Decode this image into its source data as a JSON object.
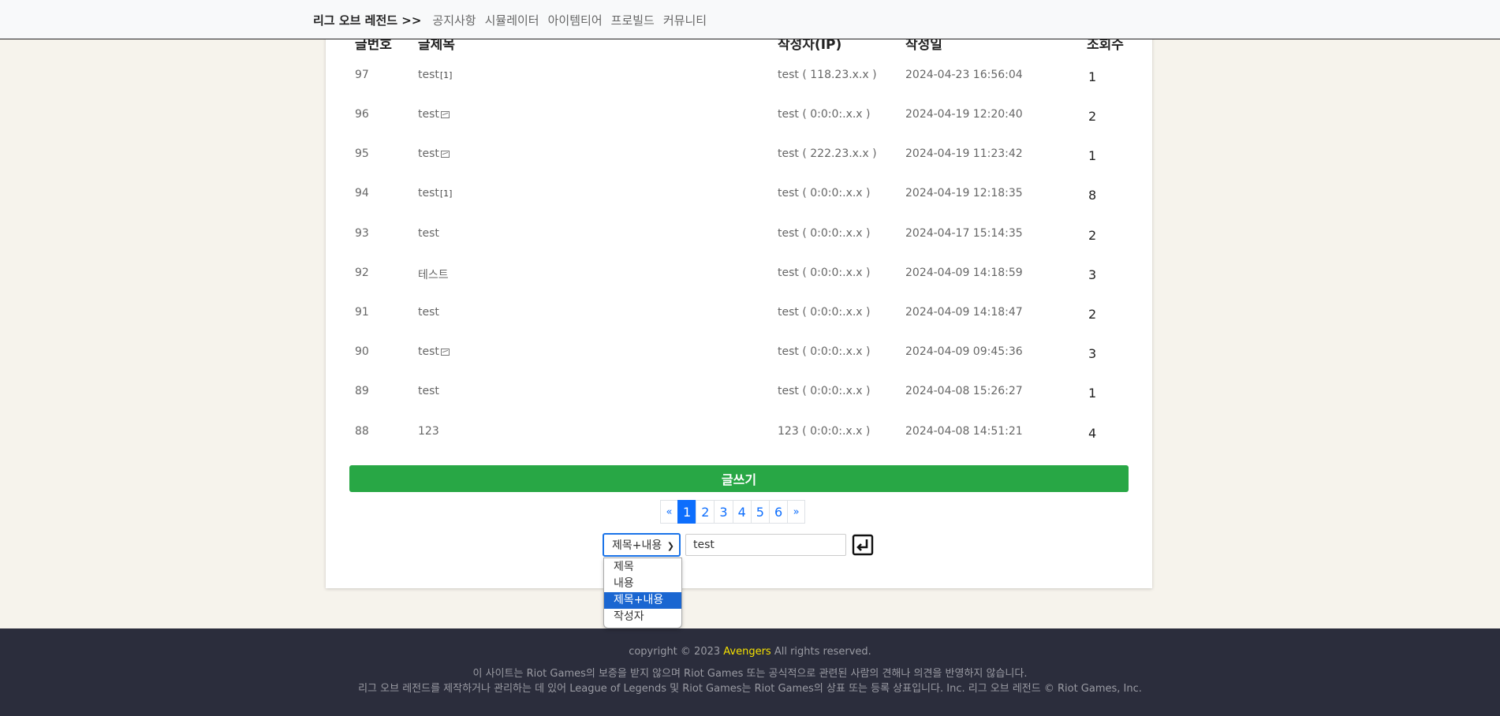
{
  "nav": {
    "brand": "리그 오브 레전드 >>",
    "links": [
      "공지사항",
      "시뮬레이터",
      "아이템티어",
      "프로빌드",
      "커뮤니티"
    ]
  },
  "table": {
    "headers": [
      "글번호",
      "글제목",
      "작성자(IP)",
      "작성일",
      "조회수"
    ],
    "rows": [
      {
        "num": "97",
        "title": "test",
        "tag": "[1]",
        "writer": "test ( 118.23.x.x )",
        "date": "2024-04-23 16:56:04",
        "views": "1"
      },
      {
        "num": "96",
        "title": "test",
        "tag": "",
        "writer": "test ( 0:0:0:.x.x )",
        "date": "2024-04-19 12:20:40",
        "views": "2"
      },
      {
        "num": "95",
        "title": "test",
        "tag": "",
        "writer": "test ( 222.23.x.x )",
        "date": "2024-04-19 11:23:42",
        "views": "1"
      },
      {
        "num": "94",
        "title": "test",
        "tag": "[1]",
        "writer": "test ( 0:0:0:.x.x )",
        "date": "2024-04-19 12:18:35",
        "views": "8"
      },
      {
        "num": "93",
        "title": "test",
        "tag": "",
        "writer": "test ( 0:0:0:.x.x )",
        "date": "2024-04-17 15:14:35",
        "views": "2"
      },
      {
        "num": "92",
        "title": "테스트",
        "tag": "",
        "writer": "test ( 0:0:0:.x.x )",
        "date": "2024-04-09 14:18:59",
        "views": "3"
      },
      {
        "num": "91",
        "title": "test",
        "tag": "",
        "writer": "test ( 0:0:0:.x.x )",
        "date": "2024-04-09 14:18:47",
        "views": "2"
      },
      {
        "num": "90",
        "title": "test",
        "tag": "",
        "writer": "test ( 0:0:0:.x.x )",
        "date": "2024-04-09 09:45:36",
        "views": "3"
      },
      {
        "num": "89",
        "title": "test",
        "tag": "",
        "writer": "test ( 0:0:0:.x.x )",
        "date": "2024-04-08 15:26:27",
        "views": "1"
      },
      {
        "num": "88",
        "title": "123",
        "tag": "",
        "writer": "123 ( 0:0:0:.x.x )",
        "date": "2024-04-08 14:51:21",
        "views": "4"
      }
    ],
    "image_icon_rows": [
      1,
      2,
      7
    ]
  },
  "write_button": "글쓰기",
  "pagination": {
    "prev": "«",
    "pages": [
      "1",
      "2",
      "3",
      "4",
      "5",
      "6"
    ],
    "active": "1",
    "next": "»"
  },
  "search": {
    "selected": "제목+내용",
    "options": [
      "제목",
      "내용",
      "제목+내용",
      "작성자"
    ],
    "query": "test"
  },
  "footer": {
    "copyright_prefix": "copyright © 2023 ",
    "copyright_brand": "Avengers",
    "copyright_suffix": " All rights reserved.",
    "line2": "이 사이트는 Riot Games의 보증을 받지 않으며 Riot Games 또는 공식적으로 관련된 사람의 견해나 의견을 반영하지 않습니다.",
    "line3": "리그 오브 레전드를 제작하거나 관리하는 데 있어 League of Legends 및 Riot Games는 Riot Games의 상표 또는 등록 상표입니다. Inc. 리그 오브 레전드 © Riot Games, Inc."
  }
}
